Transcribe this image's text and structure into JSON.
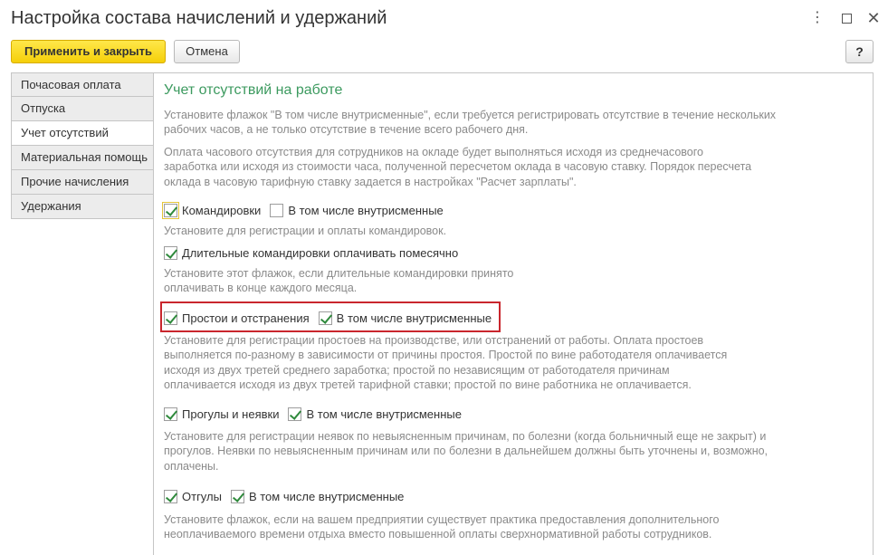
{
  "window": {
    "title": "Настройка состава начислений и удержаний",
    "more_icon": "⋮",
    "close_icon": "✕"
  },
  "toolbar": {
    "apply_close_label": "Применить и закрыть",
    "cancel_label": "Отмена",
    "help_label": "?"
  },
  "tabs": [
    {
      "label": "Почасовая оплата",
      "active": false
    },
    {
      "label": "Отпуска",
      "active": false
    },
    {
      "label": "Учет отсутствий",
      "active": true
    },
    {
      "label": "Материальная помощь",
      "active": false
    },
    {
      "label": "Прочие начисления",
      "active": false
    },
    {
      "label": "Удержания",
      "active": false
    }
  ],
  "section": {
    "title": "Учет отсутствий на работе",
    "intro_1": [
      "Установите флажок \"В том числе внутрисменные\", если требуется регистрировать отсутствие в течение нескольких",
      "рабочих часов, а не только отсутствие в течение всего рабочего дня."
    ],
    "intro_2": [
      "Оплата часового отсутствия для сотрудников на окладе будет выполняться исходя из среднечасового",
      "заработка или исходя из стоимости часа, полученной пересчетом оклада в часовую ставку. Порядок пересчета",
      "оклада в часовую тарифную ставку задается в настройках \"Расчет зарплаты\"."
    ],
    "business_trips": {
      "label": "Командировки",
      "checked": true,
      "intrashift_label": "В том числе внутрисменные",
      "intrashift_checked": false,
      "hint": [
        "Установите для регистрации и оплаты командировок."
      ]
    },
    "long_trips": {
      "label": "Длительные командировки оплачивать помесячно",
      "checked": true,
      "hint": [
        "Установите этот флажок, если длительные командировки принято",
        "оплачивать в конце каждого месяца."
      ]
    },
    "downtime": {
      "label": "Простои и отстранения",
      "checked": true,
      "intrashift_label": "В том числе внутрисменные",
      "intrashift_checked": true,
      "hint": [
        "Установите для регистрации простоев на производстве, или отстранений от работы. Оплата простоев",
        "выполняется по-разному в зависимости от причины простоя. Простой по вине работодателя оплачивается",
        "исходя из двух третей среднего заработка; простой по независящим от работодателя причинам",
        "оплачивается исходя из двух третей тарифной ставки; простой по вине работника не оплачивается."
      ]
    },
    "absences": {
      "label": "Прогулы и неявки",
      "checked": true,
      "intrashift_label": "В том числе внутрисменные",
      "intrashift_checked": true,
      "hint": [
        "Установите для регистрации неявок по невыясненным причинам, по болезни (когда больничный еще не закрыт) и",
        "прогулов. Неявки по невыясненным причинам или по болезни в дальнейшем должны быть уточнены и, возможно,",
        "оплачены."
      ]
    },
    "time_off": {
      "label": "Отгулы",
      "checked": true,
      "intrashift_label": "В том числе внутрисменные",
      "intrashift_checked": true,
      "hint": [
        "Установите флажок, если на вашем предприятии существует практика предоставления дополнительного",
        "неоплачиваемого времени отдыха вместо повышенной оплаты сверхнормативной работы сотрудников."
      ]
    }
  },
  "colors": {
    "accent_title": "#3c9a5f",
    "highlight_border": "#c9262d",
    "primary_button": "#f5cf09",
    "check_mark": "#2f8a3c"
  }
}
